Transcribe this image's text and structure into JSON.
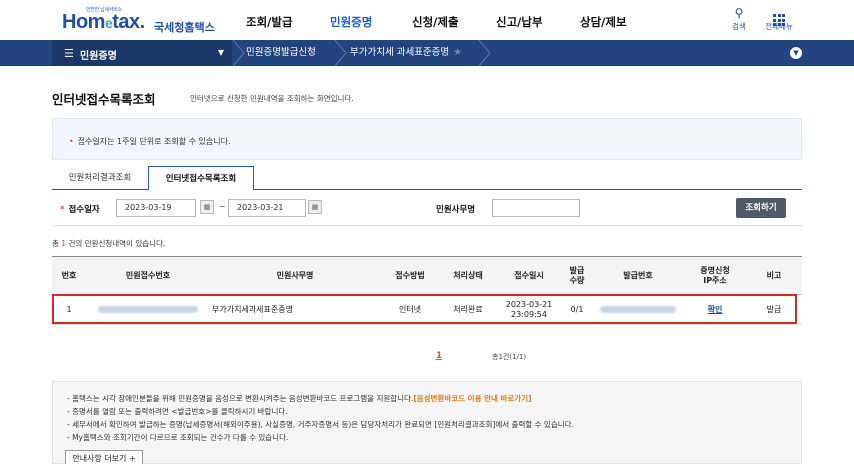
{
  "header": {
    "logo_tiny": "안전한 납세서비스",
    "logo_word_a": "Hom",
    "logo_word_e": "e",
    "logo_word_b": "tax.",
    "logo_kr": "국세청홈택스",
    "gnb": [
      "조회/발급",
      "민원증명",
      "신청/제출",
      "신고/납부",
      "상담/제보"
    ],
    "active_gnb": "민원증명",
    "search_label": "검색",
    "menu_label": "전체메뉴"
  },
  "navbar": {
    "menu_title": "민원증명",
    "crumbs": [
      "민원증명발급신청",
      "부가가치세 과세표준증명"
    ]
  },
  "page": {
    "title": "인터넷접수목록조회",
    "description": "인터넷으로 신청한 민원내역을 조회하는 화면입니다."
  },
  "info": {
    "text": "접수일자는 1주일 단위로 조회할 수 있습니다."
  },
  "tabs": [
    "민원처리결과조회",
    "인터넷접수목록조회"
  ],
  "search": {
    "date_label": "접수일자",
    "date_from": "2023-03-19",
    "date_sep": "~",
    "date_to": "2023-03-21",
    "office_label": "민원사무명",
    "office_value": "",
    "button": "조회하기"
  },
  "count": {
    "prefix": "총 ",
    "num": "1",
    "suffix": " 건의 민원신청내역이 있습니다."
  },
  "table": {
    "headers": [
      "번호",
      "민원접수번호",
      "민원사무명",
      "접수방법",
      "처리상태",
      "접수일시",
      "발급\n수량",
      "발급번호",
      "증명신청\nIP주소",
      "비고"
    ],
    "rows": [
      {
        "no": "1",
        "office": "부가가치세과세표준증명",
        "method": "인터넷",
        "status": "처리완료",
        "date": "2023-03-21",
        "time": "23:09:54",
        "qty": "0/1",
        "ip_link": "확인",
        "note": "발급"
      }
    ]
  },
  "pager": {
    "current": "1",
    "total": "총1건(1/1)"
  },
  "notice": {
    "line1": "- 홈택스는 시각 장애인분들을 위해 민원증명을 음성으로 변환시켜주는 음성변환바코드 프로그램을 지원합니다.",
    "line1_link": "[음성변환바코드 이용 안내 바로가기]",
    "line2": "- 증명서를 열람 또는 출력하려면 <발급번호>를 클릭하시기 바랍니다.",
    "line3": "- 세무서에서 확인하여 발급하는 증명(납세증명서(해외이주용), 사실증명, 거주자증명서 등)은 담당자처리가 완료되면 [민원처리결과조회]에서 출력할 수 있습니다.",
    "line4": "- My홈택스와 조회기간이 다르므로 조회되는 건수가 다를 수 있습니다.",
    "more_button": "안내사항 더보기 +"
  }
}
